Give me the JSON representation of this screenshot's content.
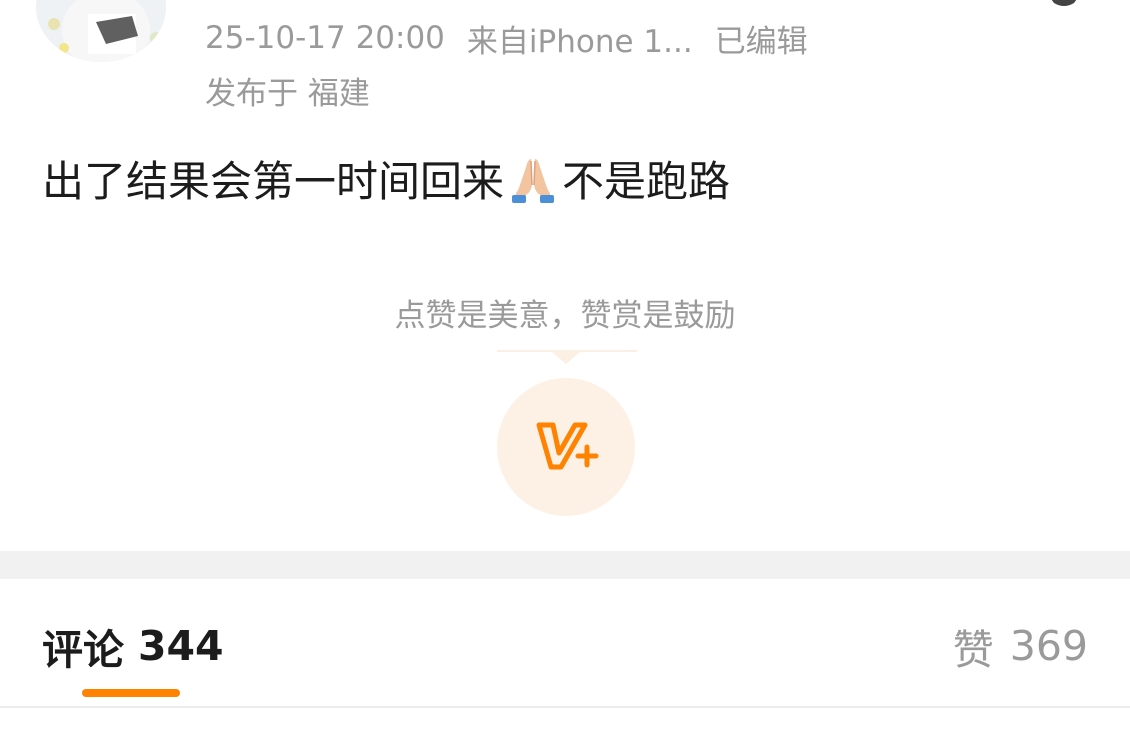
{
  "post": {
    "timestamp": "25-10-17 20:00",
    "source": "来自iPhone 1...",
    "edited": "已编辑",
    "location": "发布于 福建",
    "text_before_emoji": "出了结果会第一时间回来",
    "emoji": "folded-hands",
    "text_after_emoji": "不是跑路"
  },
  "reward": {
    "hint": "点赞是美意，赞赏是鼓励",
    "icon": "reward-v-plus-icon",
    "accent_color": "#ff8200"
  },
  "tabs": {
    "comments_label": "评论",
    "comments_count": "344",
    "likes_label": "赞",
    "likes_count": "369"
  },
  "colors": {
    "text_primary": "#1c1c1c",
    "text_secondary": "#9a9a9a",
    "accent": "#ff8200",
    "divider": "#f1f1f1"
  }
}
